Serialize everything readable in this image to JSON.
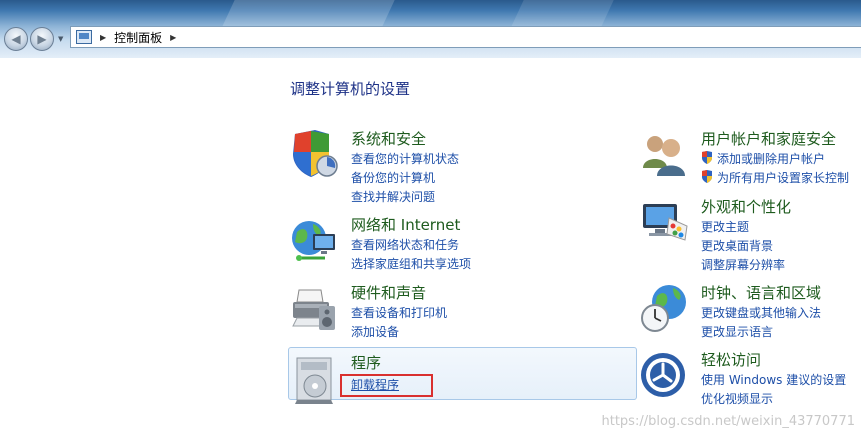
{
  "address_bar": {
    "path": "控制面板"
  },
  "page_title": "调整计算机的设置",
  "categories_left": [
    {
      "title": "系统和安全",
      "links": [
        "查看您的计算机状态",
        "备份您的计算机",
        "查找并解决问题"
      ]
    },
    {
      "title": "网络和 Internet",
      "links": [
        "查看网络状态和任务",
        "选择家庭组和共享选项"
      ]
    },
    {
      "title": "硬件和声音",
      "links": [
        "查看设备和打印机",
        "添加设备"
      ]
    },
    {
      "title": "程序",
      "links": [
        "卸载程序"
      ]
    }
  ],
  "categories_right": [
    {
      "title": "用户帐户和家庭安全",
      "links": [
        "添加或删除用户帐户",
        "为所有用户设置家长控制"
      ]
    },
    {
      "title": "外观和个性化",
      "links": [
        "更改主题",
        "更改桌面背景",
        "调整屏幕分辨率"
      ]
    },
    {
      "title": "时钟、语言和区域",
      "links": [
        "更改键盘或其他输入法",
        "更改显示语言"
      ]
    },
    {
      "title": "轻松访问",
      "links": [
        "使用 Windows 建议的设置",
        "优化视频显示"
      ]
    }
  ],
  "watermark": "https://blog.csdn.net/weixin_43770771",
  "colors": {
    "category_title": "#1e5b1e",
    "link": "#1e4fa8",
    "page_title": "#1e3287",
    "highlight_box": "#d9302f"
  },
  "icons": {
    "system_security": "shield-icon",
    "network": "globe-network-icon",
    "hardware": "printer-icon",
    "programs": "program-disc-icon",
    "user_accounts": "users-icon",
    "appearance": "monitor-palette-icon",
    "clock_language": "globe-clock-icon",
    "ease_of_access": "ease-of-access-icon"
  }
}
